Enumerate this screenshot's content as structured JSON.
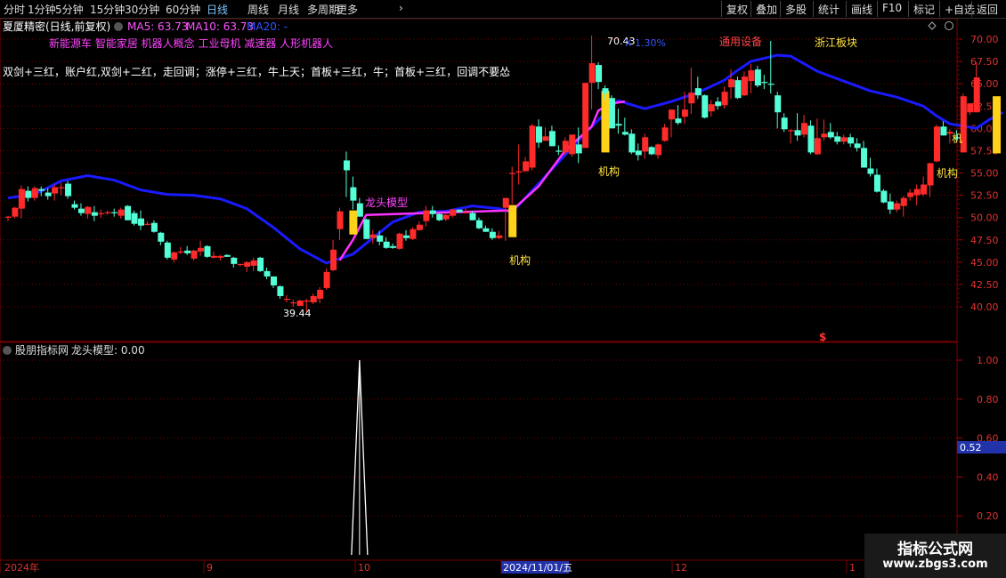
{
  "toolbar": {
    "period_tabs": [
      "分时",
      "1分钟",
      "5分钟",
      "15分钟",
      "30分钟",
      "60分钟",
      "日线",
      "周线",
      "月线",
      "多周期",
      "更多"
    ],
    "active_tab": "日线",
    "right_buttons": [
      "复权",
      "叠加",
      "多股",
      "统计",
      "画线",
      "F10",
      "标记",
      "+自选",
      "返回"
    ]
  },
  "stock": {
    "title": "夏厦精密(日线,前复权)",
    "ma_labels": [
      {
        "text": "MA5: 63.73",
        "color": "#ff55ff"
      },
      {
        "text": "MA10: 63.73",
        "color": "#ff55ff"
      },
      {
        "text": "MA20: -",
        "color": "#3355ff"
      }
    ],
    "concepts": "新能源车 智能家居 机器人概念 工业母机 减速器 人形机器人",
    "formula_text": "双剑+三红，账户红,双剑+二红，走回调；涨停+三红，牛上天；首板+三红，牛；首板+三红，回调不要怂"
  },
  "annotations": {
    "high_marker": "70.43",
    "low_marker": "39.44",
    "pct_text": "X  1.30%",
    "sector1": "通用设备",
    "sector2": "浙江板块",
    "dragon_label": "龙头模型",
    "inst_label": "机构",
    "inst_partial": "机",
    "s_marker": "$"
  },
  "indicator": {
    "title": "股朋指标网",
    "label": "龙头模型: 0.00",
    "current_value": "0.52"
  },
  "dates": {
    "year_label": "2024年",
    "sep_label": "9",
    "oct_label": "10",
    "cursor_date": "2024/11/01/五",
    "dec_label": "12",
    "jan_label": "1"
  },
  "watermark": {
    "line1": "指标公式网",
    "line2": "www.zbgs3.com"
  },
  "colors": {
    "up": "#ff2a2a",
    "down": "#54ffd8",
    "ma20": "#1a1aff",
    "ma_pink": "#ff33ff",
    "inst": "#ffd21a",
    "grid_red": "#7a0000"
  },
  "chart_data": {
    "type": "candlestick",
    "y_axis_ticks": [
      40.0,
      42.5,
      45.0,
      47.5,
      50.0,
      52.5,
      55.0,
      57.5,
      60.0,
      62.5,
      65.0,
      67.5,
      70.0
    ],
    "ylim": [
      38.0,
      71.5
    ],
    "grid": true,
    "ohlc": [
      [
        50,
        50.2,
        49.6,
        50.1
      ],
      [
        50.1,
        51.2,
        49.9,
        51.1
      ],
      [
        51,
        53.6,
        49.9,
        53.2
      ],
      [
        53,
        53.5,
        51.8,
        52.2
      ],
      [
        52.2,
        53.5,
        51.9,
        53.3
      ],
      [
        53.2,
        53.5,
        52.4,
        53
      ],
      [
        52.8,
        53.3,
        52,
        52.4
      ],
      [
        52.7,
        53.7,
        51.9,
        53.4
      ],
      [
        53.3,
        53.9,
        52.5,
        53.4
      ],
      [
        53.8,
        54.1,
        52.1,
        52.4
      ],
      [
        51.5,
        51.9,
        50.9,
        51.1
      ],
      [
        51,
        51.6,
        50.2,
        50.5
      ],
      [
        50.4,
        51.3,
        49.9,
        51.2
      ],
      [
        50.6,
        51.3,
        49.6,
        50.2
      ],
      [
        50.4,
        50.9,
        50,
        50.5
      ],
      [
        50.6,
        50.8,
        50.3,
        50.6
      ],
      [
        50.6,
        51,
        50.1,
        50.5
      ],
      [
        50.2,
        51.1,
        49.9,
        50.9
      ],
      [
        51.3,
        51.4,
        49.7,
        49.7
      ],
      [
        50.5,
        50.8,
        49.1,
        49.3
      ],
      [
        49.9,
        50.8,
        48.6,
        49.1
      ],
      [
        49.2,
        49.6,
        49.1,
        49.3
      ],
      [
        49.4,
        49.7,
        48.3,
        48.4
      ],
      [
        48.3,
        48.4,
        46.9,
        47.3
      ],
      [
        47.2,
        47.4,
        45.3,
        45.5
      ],
      [
        45.3,
        46.2,
        45,
        46.1
      ],
      [
        46.2,
        46.7,
        45.9,
        46.2
      ],
      [
        46.3,
        46.8,
        45.8,
        46
      ],
      [
        45.4,
        46.4,
        45.2,
        46.3
      ],
      [
        46.2,
        47.4,
        45.7,
        46.6
      ],
      [
        46.8,
        46.9,
        45.5,
        45.6
      ],
      [
        45.5,
        46.2,
        45.4,
        45.7
      ],
      [
        45.5,
        45.8,
        45.2,
        45.7
      ],
      [
        45.8,
        45.9,
        45.6,
        45.6
      ],
      [
        45.5,
        45.6,
        44.4,
        44.8
      ],
      [
        44.7,
        44.8,
        44.5,
        44.8
      ],
      [
        44.5,
        45.1,
        43.9,
        45
      ],
      [
        44.6,
        45.5,
        44,
        45.2
      ],
      [
        45.5,
        45.6,
        43.9,
        44
      ],
      [
        44,
        44.4,
        43.1,
        43.4
      ],
      [
        43.4,
        43.4,
        42.1,
        42.4
      ],
      [
        42.3,
        42.4,
        40.9,
        41.2
      ],
      [
        40.9,
        41.3,
        40.5,
        40.9
      ],
      [
        40.4,
        40.8,
        40,
        40.5
      ],
      [
        40.1,
        40.8,
        40.2,
        40.7
      ],
      [
        40.6,
        40.9,
        39.4,
        40.7
      ],
      [
        40.5,
        41.5,
        40.3,
        41.2
      ],
      [
        40.9,
        42.2,
        40.4,
        41.9
      ],
      [
        42.1,
        44.3,
        41.9,
        43.9
      ],
      [
        44.1,
        47.5,
        44,
        46.4
      ],
      [
        48.7,
        51.1,
        47.5,
        50.7
      ],
      [
        56.4,
        57.4,
        52.3,
        55.3
      ],
      [
        53.4,
        54.6,
        50.9,
        51.9
      ],
      [
        51.6,
        52.2,
        50.1,
        50.1
      ],
      [
        49.8,
        49.9,
        47.6,
        47.6
      ],
      [
        47.7,
        48.6,
        47.1,
        48.1
      ],
      [
        48,
        48.5,
        46.9,
        47.3
      ],
      [
        47.3,
        47.8,
        46.5,
        46.6
      ],
      [
        46.8,
        47.1,
        46.5,
        46.6
      ],
      [
        46.5,
        48.3,
        46.4,
        48.2
      ],
      [
        48,
        48.6,
        47.4,
        47.7
      ],
      [
        47.6,
        48.9,
        47.5,
        48.7
      ],
      [
        48.6,
        49.6,
        48.5,
        49.2
      ],
      [
        49.6,
        51.3,
        49,
        50.8
      ],
      [
        50.8,
        51.3,
        50,
        50.4
      ],
      [
        50.4,
        50.5,
        49.6,
        49.7
      ],
      [
        49.8,
        50.4,
        49.6,
        50.3
      ],
      [
        50.2,
        51,
        50,
        50.9
      ],
      [
        50.9,
        50.9,
        50.6,
        50.6
      ],
      [
        50.6,
        51,
        50.5,
        50.6
      ],
      [
        50.5,
        50.7,
        49.7,
        49.7
      ],
      [
        49.7,
        50,
        48.7,
        48.8
      ],
      [
        48.8,
        49.1,
        48.4,
        48.4
      ],
      [
        48.4,
        48.8,
        47.5,
        47.7
      ],
      [
        47.7,
        48.5,
        47.6,
        48
      ],
      [
        51.1,
        52.2,
        47.4,
        52.2
      ],
      [
        54.9,
        55.7,
        51.5,
        55
      ],
      [
        55.1,
        58.2,
        53.7,
        55.2
      ],
      [
        55.2,
        56.8,
        55.1,
        56.3
      ],
      [
        55.6,
        60.5,
        55.3,
        60.3
      ],
      [
        60.2,
        61,
        57.8,
        58.4
      ],
      [
        58.6,
        60.1,
        58.6,
        59.1
      ],
      [
        59.7,
        60.3,
        58,
        58
      ],
      [
        57.5,
        58.1,
        57,
        57.4
      ],
      [
        57.3,
        59,
        57,
        58.6
      ],
      [
        57.1,
        59.3,
        56.8,
        59.3
      ],
      [
        58.2,
        60.1,
        56.1,
        57.2
      ],
      [
        57.8,
        65.1,
        57.8,
        65.1
      ],
      [
        65.1,
        70.4,
        62.1,
        67.3
      ],
      [
        67.1,
        67.4,
        64.4,
        65.2
      ],
      [
        64.5,
        64.8,
        63.2,
        63.9
      ],
      [
        63.4,
        63.7,
        60,
        60
      ],
      [
        60.5,
        62.2,
        59.4,
        60.3
      ],
      [
        59.6,
        61.2,
        59.2,
        59.3
      ],
      [
        59.4,
        59.9,
        57.1,
        57.3
      ],
      [
        57.5,
        58.3,
        56.4,
        57
      ],
      [
        57.4,
        59.4,
        56.6,
        59
      ],
      [
        57.9,
        58,
        57,
        57.1
      ],
      [
        57,
        58.3,
        56.6,
        58.2
      ],
      [
        58.6,
        60.5,
        58.5,
        60.1
      ],
      [
        61,
        62.1,
        59,
        62.1
      ],
      [
        61.1,
        62.6,
        60.4,
        60.6
      ],
      [
        61.3,
        64.1,
        60.5,
        62.1
      ],
      [
        62.8,
        66.8,
        61.6,
        64
      ],
      [
        64.5,
        65.8,
        63.3,
        63.7
      ],
      [
        63.7,
        63.8,
        61.1,
        61.2
      ],
      [
        61.9,
        63.2,
        61.3,
        62.7
      ],
      [
        63,
        63.5,
        62.1,
        62.5
      ],
      [
        62.6,
        64.7,
        62.2,
        64.1
      ],
      [
        64.6,
        66.6,
        63.3,
        65.5
      ],
      [
        65.4,
        65.8,
        63.3,
        63.4
      ],
      [
        63.7,
        66.4,
        63.6,
        65.8
      ],
      [
        65.3,
        67.2,
        63.9,
        66.5
      ],
      [
        66.6,
        67,
        64.6,
        64.8
      ],
      [
        65.2,
        66,
        64.4,
        65.1
      ],
      [
        65,
        69.8,
        63.9,
        64.9
      ],
      [
        63.7,
        64.1,
        60,
        61.8
      ],
      [
        61.2,
        61.7,
        59.6,
        59.9
      ],
      [
        59.8,
        59.9,
        58.3,
        59.8
      ],
      [
        59.8,
        61.7,
        58.6,
        59.2
      ],
      [
        59.3,
        61.5,
        59,
        60.6
      ],
      [
        60.3,
        60.9,
        57.1,
        57.3
      ],
      [
        57.1,
        61.1,
        57,
        58.9
      ],
      [
        59,
        61,
        58.6,
        59.4
      ],
      [
        59.6,
        60.6,
        58.8,
        59
      ],
      [
        59.1,
        59.6,
        58.2,
        58.5
      ],
      [
        58.5,
        59.3,
        58.2,
        59
      ],
      [
        59,
        59.4,
        57.9,
        58.3
      ],
      [
        58.3,
        58.9,
        57.4,
        57.8
      ],
      [
        57.8,
        58.6,
        55.6,
        55.6
      ],
      [
        55.5,
        56.7,
        54.6,
        54.9
      ],
      [
        54.8,
        55.5,
        52.8,
        52.9
      ],
      [
        53,
        53.2,
        51.6,
        51.7
      ],
      [
        51.8,
        52.7,
        50.4,
        50.9
      ],
      [
        50.9,
        51.9,
        50.6,
        51.6
      ],
      [
        51.3,
        52.4,
        50.1,
        52.2
      ],
      [
        52.3,
        53.2,
        51.9,
        52.8
      ],
      [
        52.5,
        53.7,
        51.4,
        53.2
      ],
      [
        52.6,
        54.6,
        52.4,
        53.7
      ],
      [
        53.6,
        56.1,
        52.3,
        56.1
      ],
      [
        56.3,
        60.4,
        56.2,
        60.2
      ],
      [
        60.2,
        60.8,
        59.2,
        59.2
      ],
      [
        59.4,
        59.9,
        58.3,
        59.6
      ],
      [
        59,
        59.8,
        58.5,
        58.9
      ],
      [
        57.3,
        63.9,
        57.3,
        63.6
      ],
      [
        61.8,
        62.8,
        61.5,
        62.8
      ],
      [
        61.8,
        67.4,
        61.8,
        65.7
      ]
    ],
    "ma20": [
      [
        0,
        52.2
      ],
      [
        4,
        52.6
      ],
      [
        8,
        54.1
      ],
      [
        12,
        54.7
      ],
      [
        16,
        54.2
      ],
      [
        20,
        53.1
      ],
      [
        24,
        52.6
      ],
      [
        28,
        52.5
      ],
      [
        32,
        52.1
      ],
      [
        36,
        51.0
      ],
      [
        40,
        48.9
      ],
      [
        44,
        46.5
      ],
      [
        48,
        44.9
      ],
      [
        52,
        45.9
      ],
      [
        58,
        49.5
      ],
      [
        62,
        50.6
      ],
      [
        66,
        50.7
      ],
      [
        70,
        51.3
      ],
      [
        74,
        51.0
      ],
      [
        76,
        50.6
      ],
      [
        88,
        60.2
      ],
      [
        92,
        63.1
      ],
      [
        96,
        62.2
      ],
      [
        100,
        63.0
      ],
      [
        104,
        64.0
      ],
      [
        108,
        65.4
      ],
      [
        110,
        66.5
      ],
      [
        112,
        67.5
      ],
      [
        116,
        68.2
      ],
      [
        118,
        68.1
      ],
      [
        122,
        66.4
      ],
      [
        126,
        65.3
      ],
      [
        130,
        64.2
      ],
      [
        134,
        63.5
      ],
      [
        138,
        62.5
      ],
      [
        140,
        61.4
      ],
      [
        142,
        60.5
      ],
      [
        146,
        60.0
      ],
      [
        148,
        61.0
      ],
      [
        150,
        61.8
      ]
    ],
    "ma_pink": [
      [
        50,
        45.2
      ],
      [
        52,
        47.5
      ],
      [
        54,
        50.3
      ],
      [
        76,
        50.8
      ],
      [
        80,
        53.5
      ],
      [
        84,
        57.5
      ],
      [
        88,
        60.2
      ],
      [
        89,
        62.0
      ],
      [
        91,
        62.8
      ],
      [
        93,
        63.0
      ]
    ],
    "inst_bars": [
      [
        52,
        48.1,
        50.8
      ],
      [
        76,
        47.8,
        51.4
      ],
      [
        90,
        57.3,
        64.2
      ],
      [
        149,
        57.2,
        63.6
      ]
    ],
    "indicator_signal": {
      "index": 53,
      "value": 1.0
    },
    "indicator_ticks": [
      0.2,
      0.4,
      0.6,
      0.8,
      1.0
    ]
  }
}
